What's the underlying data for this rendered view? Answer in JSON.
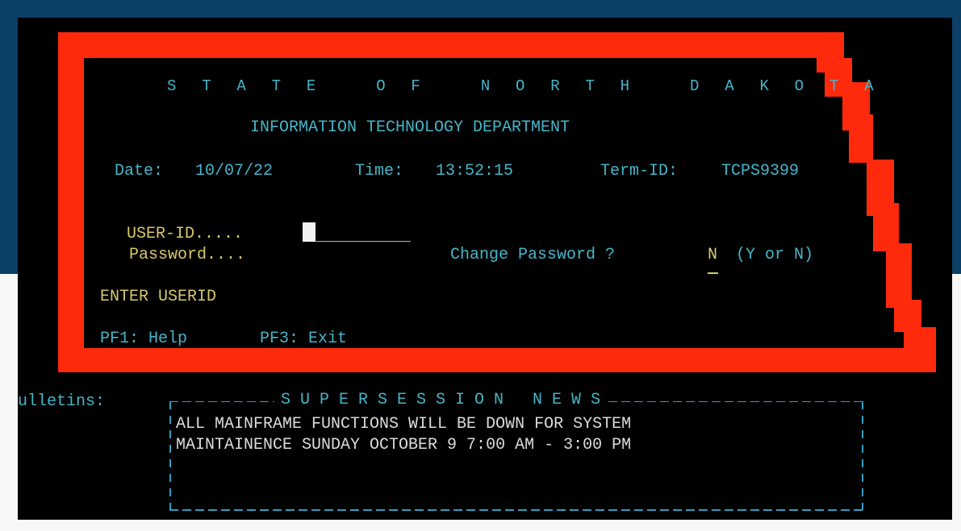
{
  "header": {
    "state_title": "S T A T E   O F   N O R T H   D A K O T A",
    "department": "INFORMATION TECHNOLOGY DEPARTMENT"
  },
  "session": {
    "date_label": "Date:",
    "date_value": "10/07/22",
    "time_label": "Time:",
    "time_value": "13:52:15",
    "term_label": "Term-ID:",
    "term_value": "TCPS9399"
  },
  "login": {
    "userid_label": "USER-ID.....",
    "password_label": "Password....",
    "change_password_label": "Change Password ?",
    "change_password_value": "N",
    "change_password_hint": "(Y or N)",
    "prompt": "ENTER USERID"
  },
  "function_keys": {
    "pf1": "PF1: Help",
    "pf3": "PF3: Exit"
  },
  "bulletins": {
    "label": "Bulletins:",
    "heading": "S U P E R S E S S I O N   N E W S",
    "lines": [
      "ALL MAINFRAME FUNCTIONS WILL BE DOWN FOR SYSTEM",
      "MAINTAINENCE SUNDAY OCTOBER 9 7:00 AM - 3:00 PM"
    ]
  },
  "colors": {
    "map_red": "#ff2a0c",
    "terminal_bg": "#000000",
    "cyan_text": "#45b5c9",
    "yellow_text": "#d7c86b",
    "outer_blue": "#0b3f66"
  }
}
